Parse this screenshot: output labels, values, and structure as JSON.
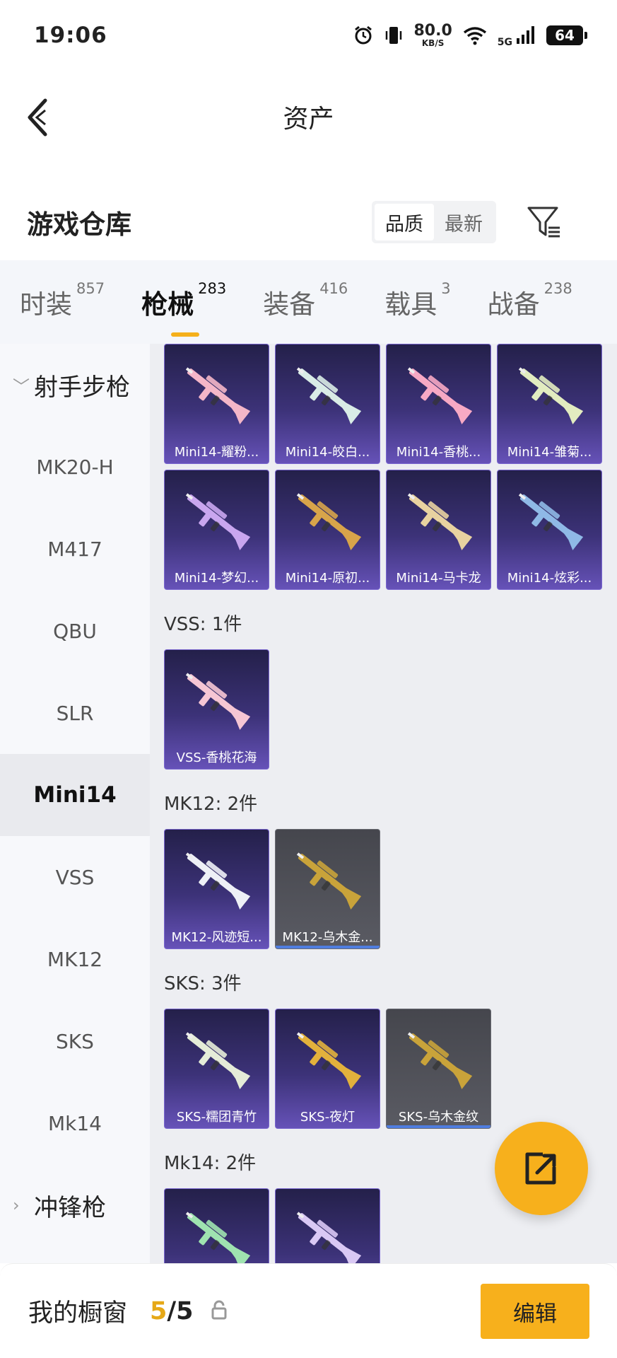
{
  "status_bar": {
    "time": "19:06",
    "net_speed_value": "80.0",
    "net_speed_unit": "KB/S",
    "network_type": "5G",
    "battery": "64",
    "icons": [
      "alarm-icon",
      "vibrate-icon",
      "wifi-icon",
      "signal-icon",
      "battery-icon"
    ]
  },
  "header": {
    "title": "资产"
  },
  "warehouse": {
    "title": "游戏仓库",
    "sort_options": [
      {
        "label": "品质",
        "active": true
      },
      {
        "label": "最新",
        "active": false
      }
    ]
  },
  "tabs": [
    {
      "label": "时装",
      "count": "857",
      "active": false
    },
    {
      "label": "枪械",
      "count": "283",
      "active": true
    },
    {
      "label": "装备",
      "count": "416",
      "active": false
    },
    {
      "label": "载具",
      "count": "3",
      "active": false
    },
    {
      "label": "战备",
      "count": "238",
      "active": false
    }
  ],
  "sidebar": {
    "group_expanded": "射手步枪",
    "items": [
      "MK20-H",
      "M417",
      "QBU",
      "SLR",
      "Mini14",
      "VSS",
      "MK12",
      "SKS",
      "Mk14"
    ],
    "active_item": "Mini14",
    "group_collapsed": "冲锋枪"
  },
  "content": {
    "mini14_items": [
      "Mini14-耀粉...",
      "Mini14-皎白...",
      "Mini14-香桃...",
      "Mini14-雏菊...",
      "Mini14-梦幻...",
      "Mini14-原初...",
      "Mini14-马卡龙",
      "Mini14-炫彩..."
    ],
    "vss": {
      "title": "VSS: 1件",
      "items": [
        "VSS-香桃花海"
      ]
    },
    "mk12": {
      "title": "MK12: 2件",
      "items": [
        "MK12-风迹短...",
        "MK12-乌木金..."
      ]
    },
    "sks": {
      "title": "SKS: 3件",
      "items": [
        "SKS-糯团青竹",
        "SKS-夜灯",
        "SKS-乌木金纹"
      ]
    },
    "mk14": {
      "title": "Mk14: 2件",
      "items": [
        "",
        ""
      ]
    }
  },
  "bottom_bar": {
    "label": "我的橱窗",
    "current": "5",
    "separator": "/",
    "total": "5",
    "edit_label": "编辑"
  },
  "colors": {
    "accent": "#f7b01c",
    "card_purple": "#3c3278",
    "card_grey": "#5a5b63"
  }
}
